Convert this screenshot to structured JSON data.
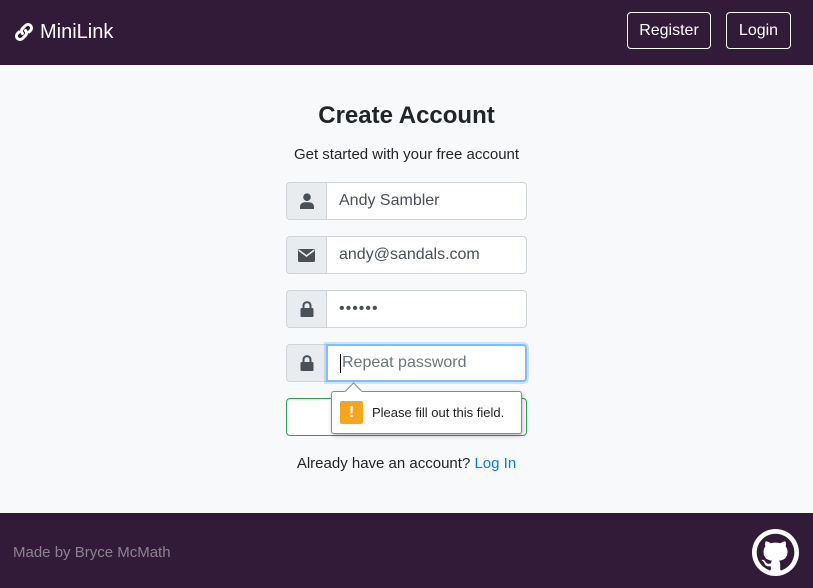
{
  "navbar": {
    "brand": "MiniLink",
    "brand_icon": "link-icon",
    "register_label": "Register",
    "login_label": "Login"
  },
  "form": {
    "title": "Create Account",
    "subtitle": "Get started with your free account",
    "name": {
      "icon": "user-icon",
      "value": "Andy Sambler"
    },
    "email": {
      "icon": "envelope-icon",
      "value": "andy@sandals.com"
    },
    "password": {
      "icon": "lock-icon",
      "value": "••••••"
    },
    "repeat_password": {
      "icon": "lock-icon",
      "placeholder": "Repeat password"
    },
    "validation_message": "Please fill out this field.",
    "login_prompt": "Already have an account?",
    "login_link": "Log In"
  },
  "footer": {
    "credit": "Made by Bryce McMath",
    "github_icon": "github-icon"
  },
  "colors": {
    "navbar_bg": "#321b38",
    "link": "#007bff",
    "submit_border": "#28a745",
    "warning": "#f8a51c",
    "focus_ring": "#80bdff"
  }
}
